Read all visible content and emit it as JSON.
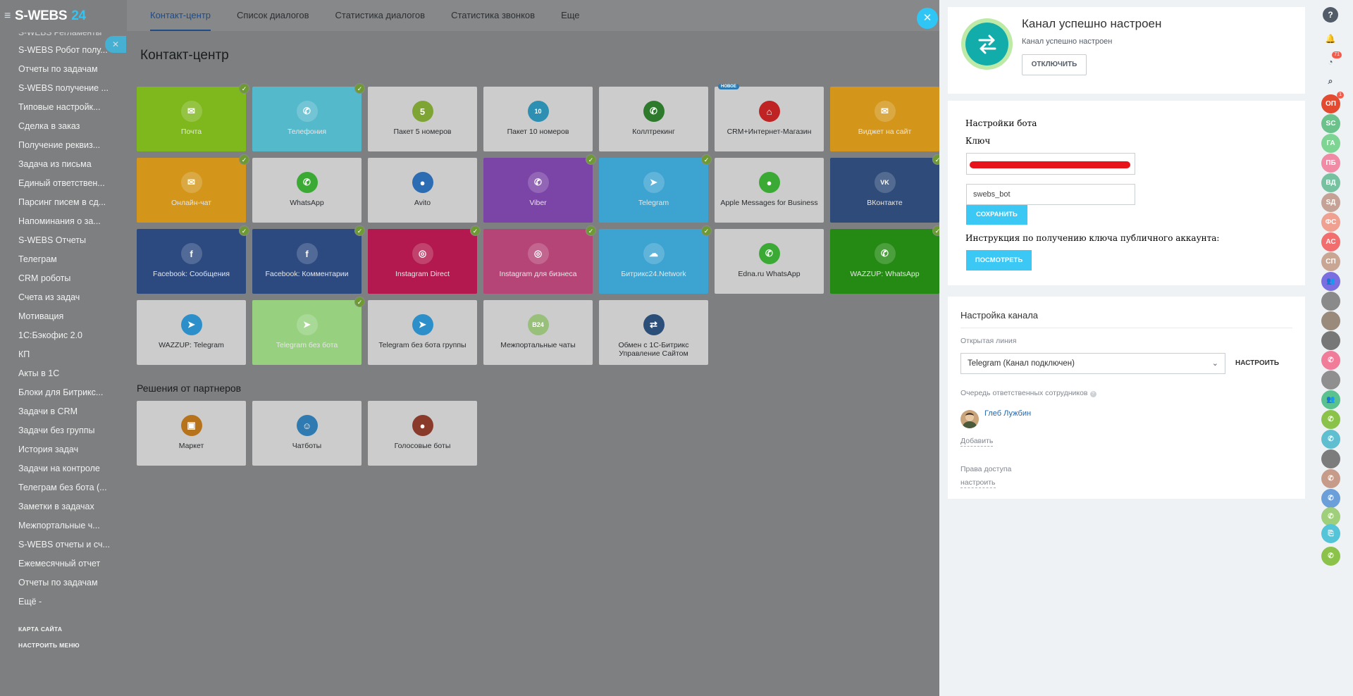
{
  "app": {
    "logo_text": "S-WEBS",
    "logo_num": "24"
  },
  "sidebar": {
    "items": [
      "S-WEBS Регламенты",
      "S-WEBS Робот полу...",
      "Отчеты по задачам",
      "S-WEBS получение ...",
      "Типовые настройк...",
      "Сделка в заказ",
      "Получение реквиз...",
      "Задача из письма",
      "Единый ответствен...",
      "Парсинг писем в сд...",
      "Напоминания о за...",
      "S-WEBS Отчеты",
      "Телеграм",
      "CRM роботы",
      "Счета из задач",
      "Мотивация",
      "1С:Бэкофис 2.0",
      "КП",
      "Акты в 1С",
      "Блоки для Битрикс...",
      "Задачи в CRM",
      "Задачи без группы",
      "История задач",
      "Задачи на контроле",
      "Телеграм без бота (...",
      "Заметки в задачах",
      "Межпортальные ч...",
      "S-WEBS отчеты и сч...",
      "Ежемесячный отчет",
      "Отчеты по задачам",
      "Ещё -"
    ],
    "sitemap": "КАРТА САЙТА",
    "menu_config": "НАСТРОИТЬ МЕНЮ"
  },
  "topnav": {
    "tabs": [
      "Контакт-центр",
      "Список диалогов",
      "Статистика диалогов",
      "Статистика звонков",
      "Еще"
    ]
  },
  "page": {
    "title": "Контакт-центр",
    "partners_title": "Решения от партнеров"
  },
  "tiles": [
    {
      "label": "Почта",
      "color": "#7eb81d",
      "icon": "envelope-icon",
      "glyph": "✉",
      "checked": true
    },
    {
      "label": "Телефония",
      "color": "#55b9cc",
      "icon": "phone-icon",
      "glyph": "✆",
      "checked": true
    },
    {
      "label": "Пакет 5 номеров",
      "color": "#cccccc",
      "icon": "number-pack-icon",
      "glyph": "5",
      "icolor": "#7ea534"
    },
    {
      "label": "Пакет 10 номеров",
      "color": "#cccccc",
      "icon": "number-pack-icon",
      "glyph": "10",
      "icolor": "#2d8fb1"
    },
    {
      "label": "Коллтрекинг",
      "color": "#cccccc",
      "icon": "calltracking-icon",
      "glyph": "✆",
      "icolor": "#2d7a2d"
    },
    {
      "label": "CRM+Интернет-Магазин",
      "color": "#cccccc",
      "icon": "shop-cart-icon",
      "glyph": "⌂",
      "icolor": "#c02323",
      "badge": "НОВОЕ"
    },
    {
      "label": "Виджет на сайт",
      "color": "#d4961a",
      "icon": "widget-icon",
      "glyph": "✉"
    },
    {
      "label": "Онлайн-чат",
      "color": "#d4961a",
      "icon": "chat-icon",
      "glyph": "✉",
      "checked": true
    },
    {
      "label": "WhatsApp",
      "color": "#cccccc",
      "icon": "whatsapp-icon",
      "glyph": "✆",
      "icolor": "#3aaa35"
    },
    {
      "label": "Avito",
      "color": "#cccccc",
      "icon": "avito-icon",
      "glyph": "●",
      "icolor": "#2b6cb3"
    },
    {
      "label": "Viber",
      "color": "#7b44a7",
      "icon": "viber-icon",
      "glyph": "✆",
      "checked": true
    },
    {
      "label": "Telegram",
      "color": "#3da4d1",
      "icon": "telegram-icon",
      "glyph": "➤",
      "checked": true
    },
    {
      "label": "Apple Messages for Business",
      "color": "#cccccc",
      "icon": "apple-messages-icon",
      "glyph": "●",
      "icolor": "#3aaa35"
    },
    {
      "label": "ВКонтакте",
      "color": "#2e4b79",
      "icon": "vk-icon",
      "glyph": "VK",
      "checked": true
    },
    {
      "label": "Facebook: Сообщения",
      "color": "#2d4a80",
      "icon": "facebook-icon",
      "glyph": "f",
      "checked": true
    },
    {
      "label": "Facebook: Комментарии",
      "color": "#2d4a80",
      "icon": "facebook-comments-icon",
      "glyph": "f",
      "checked": true
    },
    {
      "label": "Instagram Direct",
      "color": "#b3194e",
      "icon": "instagram-icon",
      "glyph": "◎",
      "checked": true
    },
    {
      "label": "Instagram для бизнеса",
      "color": "#b64577",
      "icon": "instagram-business-icon",
      "glyph": "◎",
      "checked": true
    },
    {
      "label": "Битрикс24.Network",
      "color": "#3da4d1",
      "icon": "cloud-icon",
      "glyph": "☁",
      "checked": true
    },
    {
      "label": "Edna.ru WhatsApp",
      "color": "#cccccc",
      "icon": "edna-icon",
      "glyph": "✆",
      "icolor": "#3aaa35"
    },
    {
      "label": "WAZZUP: WhatsApp",
      "color": "#248a13",
      "icon": "wazzup-whatsapp-icon",
      "glyph": "✆",
      "checked": true
    },
    {
      "label": "WAZZUP: Telegram",
      "color": "#cccccc",
      "icon": "wazzup-telegram-icon",
      "glyph": "➤",
      "icolor": "#2c8fc9"
    },
    {
      "label": "Telegram без бота",
      "color": "#97d17f",
      "icon": "telegram-nobot-icon",
      "glyph": "➤",
      "icolor": "#2c8fc9",
      "checked": true
    },
    {
      "label": "Telegram без бота группы",
      "color": "#cccccc",
      "icon": "telegram-group-icon",
      "glyph": "➤",
      "icolor": "#2c8fc9"
    },
    {
      "label": "Межпортальные чаты",
      "color": "#cccccc",
      "icon": "b24-icon",
      "glyph": "B24",
      "icolor": "#99c07a"
    },
    {
      "label": "Обмен с 1С-Битрикс Управление Сайтом",
      "color": "#cccccc",
      "icon": "exchange-icon",
      "glyph": "⇄",
      "icolor": "#2c4f7a"
    }
  ],
  "partner_tiles": [
    {
      "label": "Маркет",
      "icon": "market-icon",
      "glyph": "▣",
      "icolor": "#b7721c"
    },
    {
      "label": "Чатботы",
      "icon": "chatbot-icon",
      "glyph": "☺",
      "icolor": "#2f7ab0"
    },
    {
      "label": "Голосовые боты",
      "icon": "voicebot-icon",
      "glyph": "●",
      "icolor": "#8a3a2a"
    }
  ],
  "panel": {
    "status_title": "Канал успешно настроен",
    "status_sub": "Канал успешно настроен",
    "disconnect": "ОТКЛЮЧИТЬ",
    "bot_settings": "Настройки бота",
    "key_label": "Ключ",
    "bot_name_value": "swebs_bot",
    "save": "СОХРАНИТЬ",
    "instruction": "Инструкция по получению ключа публичного аккаунта:",
    "view": "ПОСМОТРЕТЬ",
    "channel_settings": "Настройка канала",
    "open_line_label": "Открытая линия",
    "open_line_value": "Telegram (Канал подключен)",
    "configure": "НАСТРОИТЬ",
    "queue_label": "Очередь ответственных сотрудников",
    "user_name": "Глеб Лужбин",
    "add": "Добавить",
    "access_label": "Права доступа",
    "access_link": "настроить"
  },
  "rail": {
    "items": [
      {
        "name": "help-icon",
        "text": "?",
        "color": "#525c69"
      },
      {
        "name": "bell-icon",
        "text": "🔔",
        "color": "transparent",
        "fg": "#525c69"
      },
      {
        "name": "clock-icon",
        "text": "◔",
        "color": "transparent",
        "fg": "#525c69",
        "badge": "71"
      },
      {
        "name": "search-icon",
        "text": "⌕",
        "color": "transparent",
        "fg": "#525c69"
      },
      {
        "name": "avatar-op",
        "text": "ОП",
        "color": "#e34a2f",
        "badge": "1"
      },
      {
        "name": "avatar-sc",
        "text": "SC",
        "color": "#6bc28a"
      },
      {
        "name": "avatar-ga",
        "text": "ГА",
        "color": "#7ed492"
      },
      {
        "name": "avatar-pb",
        "text": "ПБ",
        "color": "#f08aa5"
      },
      {
        "name": "avatar-vd",
        "text": "ВД",
        "color": "#76c2a0"
      },
      {
        "name": "avatar-sd",
        "text": "SД",
        "color": "#c5a295"
      },
      {
        "name": "avatar-fs",
        "text": "ФС",
        "color": "#f0a090"
      },
      {
        "name": "avatar-as",
        "text": "АС",
        "color": "#f26e6e"
      },
      {
        "name": "avatar-sp",
        "text": "СП",
        "color": "#c9a694"
      },
      {
        "name": "group-icon",
        "text": "👥",
        "color": "#7a6ee0"
      },
      {
        "name": "avatar-photo-1",
        "text": "",
        "color": "#8a8a8a"
      },
      {
        "name": "avatar-photo-2",
        "text": "",
        "color": "#9a8a7c"
      },
      {
        "name": "avatar-photo-3",
        "text": "",
        "color": "#777777"
      },
      {
        "name": "phone-call-icon",
        "text": "✆",
        "color": "#f07c9a"
      },
      {
        "name": "avatar-photo-4",
        "text": "",
        "color": "#8f8f8f"
      },
      {
        "name": "group-icon-2",
        "text": "👥",
        "color": "#59c28e"
      },
      {
        "name": "phone-call-icon-2",
        "text": "✆",
        "color": "#8bc34a"
      },
      {
        "name": "phone-call-icon-3",
        "text": "✆",
        "color": "#5fbfd0"
      },
      {
        "name": "avatar-photo-5",
        "text": "",
        "color": "#7c7c7c"
      },
      {
        "name": "phone-call-icon-4",
        "text": "✆",
        "color": "#c79b8a"
      },
      {
        "name": "phone-call-icon-5",
        "text": "✆",
        "color": "#6b9fd9"
      },
      {
        "name": "phone-call-icon-6",
        "text": "✆",
        "color": "#9fcf7a"
      },
      {
        "name": "phone-call-icon-7",
        "text": "⎘",
        "color": "#54c4d8"
      },
      {
        "name": "call-button-icon",
        "text": "✆",
        "color": "#8bc34a"
      }
    ]
  },
  "colors": {
    "accent": "#2fc6f6",
    "success": "#bdeaa6",
    "teal": "#12acaa",
    "link": "#2067b0"
  }
}
